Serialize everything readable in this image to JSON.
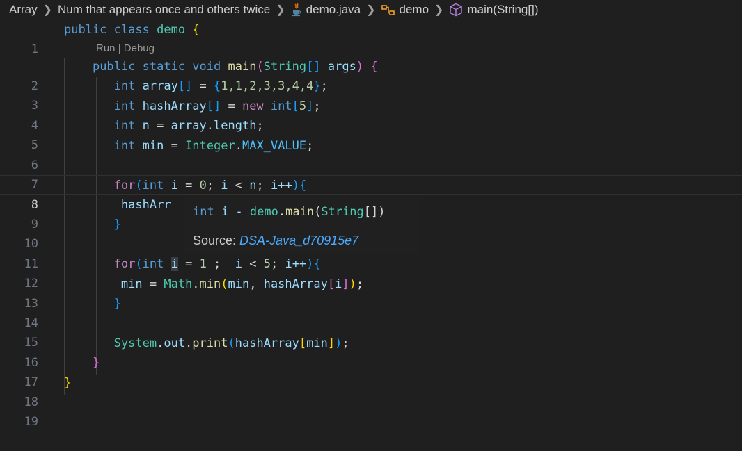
{
  "breadcrumb": {
    "items": [
      "Array",
      "Num that appears once and others twice",
      "demo.java",
      "demo",
      "main(String[])"
    ],
    "icons": [
      "java-file-icon",
      "class-icon",
      "method-cube-icon"
    ]
  },
  "codelens": {
    "run": "Run",
    "sep": " | ",
    "debug": "Debug"
  },
  "line_numbers": [
    "1",
    "2",
    "3",
    "4",
    "5",
    "6",
    "7",
    "8",
    "9",
    "10",
    "11",
    "12",
    "13",
    "14",
    "15",
    "16",
    "17",
    "18",
    "19"
  ],
  "current_line": "8",
  "code": {
    "l1": [
      "public",
      "class",
      "demo",
      "{"
    ],
    "l2": [
      "public",
      "static",
      "void",
      "main",
      "String",
      "args"
    ],
    "l3": [
      "int",
      "array",
      "1,1,2,3,3,4,4"
    ],
    "l4": [
      "int",
      "hashArray",
      "new",
      "int",
      "5"
    ],
    "l5": [
      "int",
      "n",
      "array",
      "length"
    ],
    "l6": [
      "int",
      "min",
      "Integer",
      "MAX_VALUE"
    ],
    "l8": [
      "for",
      "int",
      "i",
      "0",
      "i",
      "n",
      "i++"
    ],
    "l9": [
      "hashArr"
    ],
    "l12": [
      "for",
      "int",
      "i",
      "1",
      "i",
      "5",
      "i++"
    ],
    "l13": [
      "min",
      "Math",
      "min",
      "min",
      "hashArray",
      "i"
    ],
    "l16": [
      "System",
      "out",
      "print",
      "hashArray",
      "min"
    ]
  },
  "hover": {
    "signature": "int i - demo.main(String[])",
    "source_label": "Source: ",
    "source_link": "DSA-Java_d70915e7"
  }
}
